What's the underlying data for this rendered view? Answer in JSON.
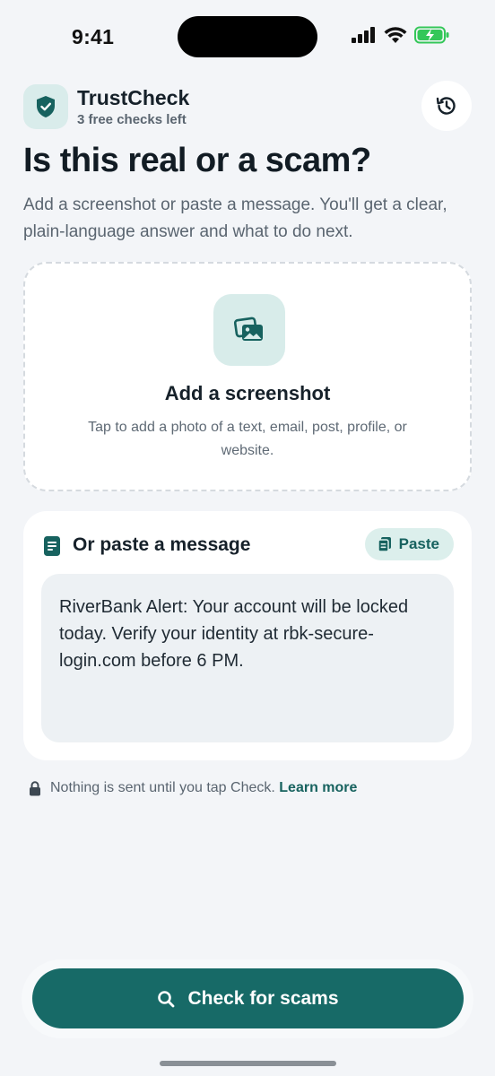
{
  "status_bar": {
    "time": "9:41"
  },
  "header": {
    "app_name": "TrustCheck",
    "subtitle": "3 free checks left",
    "logo_icon": "shield-check-icon",
    "history_icon": "history-icon"
  },
  "main": {
    "title": "Is this real or a scam?",
    "description": "Add a screenshot or paste a message. You'll get a clear, plain-language answer and what to do next."
  },
  "upload": {
    "icon": "photos-icon",
    "title": "Add a screenshot",
    "description": "Tap to add a photo of a text, email, post, profile, or website."
  },
  "paste": {
    "icon": "document-icon",
    "title": "Or paste a message",
    "button_label": "Paste",
    "button_icon": "clipboard-icon",
    "message": "RiverBank Alert: Your account will be locked today. Verify your identity at rbk-secure-login.com before 6 PM."
  },
  "privacy": {
    "icon": "lock-icon",
    "text": "Nothing is sent until you tap Check.",
    "link": "Learn more"
  },
  "cta": {
    "label": "Check for scams",
    "icon": "search-icon"
  },
  "colors": {
    "accent": "#176a67",
    "accent_light": "#d9eceb",
    "background": "#f3f5f8"
  }
}
